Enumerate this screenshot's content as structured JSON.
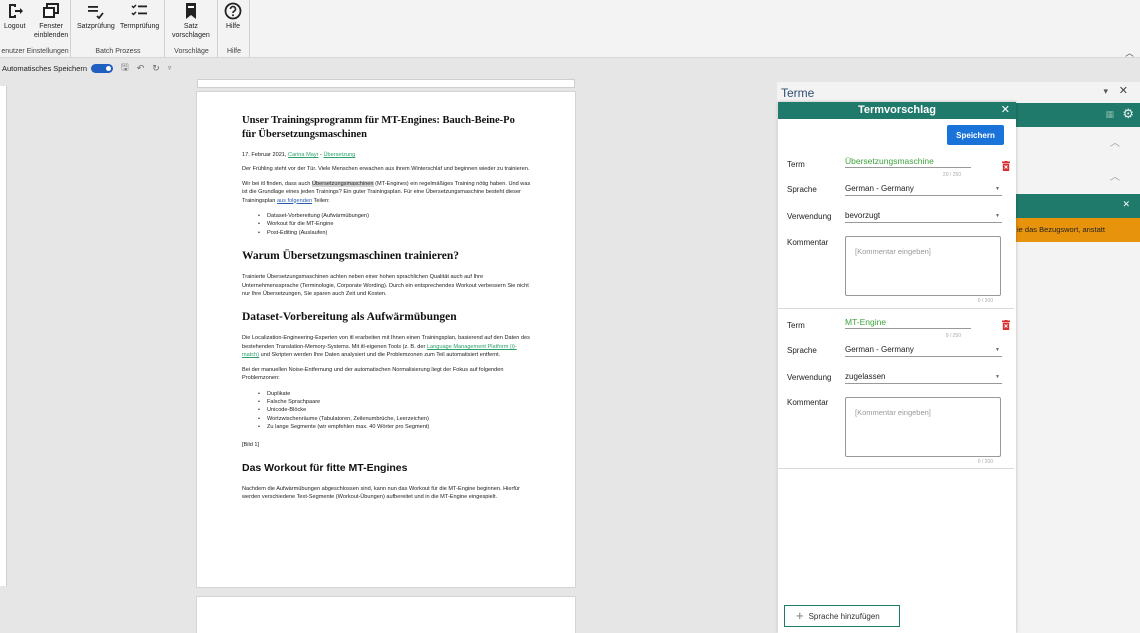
{
  "ribbon": {
    "groups": [
      {
        "label": "Benutzer Einstellungen",
        "buttons": [
          "Logout",
          "Fenster einblenden"
        ]
      },
      {
        "label": "Batch Prozess",
        "buttons": [
          "Satzprüfung",
          "Termprüfung"
        ]
      },
      {
        "label": "Vorschläge",
        "buttons": [
          "Satz vorschlagen"
        ]
      },
      {
        "label": "Hilfe",
        "buttons": [
          "Hilfe"
        ]
      }
    ],
    "logout": "Logout",
    "fenster_line1": "Fenster",
    "fenster_line2": "einblenden",
    "satzpruefung": "Satzprüfung",
    "termpruefung": "Termprüfung",
    "satz_line1": "Satz",
    "satz_line2": "vorschlagen",
    "hilfe": "Hilfe",
    "group_benutzer": "enutzer Einstellungen",
    "group_batch": "Batch Prozess",
    "group_vorschlaege": "Vorschläge",
    "group_hilfe": "Hilfe"
  },
  "qat": {
    "autosave_label": "Automatisches Speichern"
  },
  "document": {
    "title": "Unser Trainingsprogramm für MT-Engines: Bauch-Beine-Po für Übersetzungsmaschinen",
    "meta_date": "17. Februar 2021, ",
    "meta_author": "Carina Mayr",
    "meta_sep": " - ",
    "meta_category": "Übersetzung",
    "p1": "Der Frühling steht vor der Tür. Viele Menschen erwachen aus ihrem Winterschlaf und beginnen wieder zu trainieren.",
    "p2_a": "Wir bei itl finden, dass auch ",
    "p2_hl": "Übersetzungsmaschinen",
    "p2_b": " (MT-Engines) ein regelmäßiges Training nötig haben. Und was ist die Grundlage eines jeden Trainings? Ein guter Trainingsplan. Für eine Übersetzungsmaschine besteht dieser Trainingsplan ",
    "p2_link": "aus folgenden",
    "p2_c": " Teilen:",
    "list1": [
      "Dataset-Vorbereitung (Aufwärmübungen)",
      "Workout für die MT-Engine",
      "Post-Editing (Auslaufen)"
    ],
    "h2_1": "Warum Übersetzungsmaschinen trainieren?",
    "p3": "Trainierte Übersetzungsmaschinen achten neben einer hohen sprachlichen Qualität auch auf Ihre Unternehmenssprache (Terminologie, Corporate Wording). Durch ein entsprechendes Workout verbessern Sie nicht nur Ihre Übersetzungen, Sie sparen auch Zeit und Kosten.",
    "h2_2": "Dataset-Vorbereitung als Aufwärmübungen",
    "p4_a": "Die Localization-Engineering-Experten von itl erarbeiten mit Ihnen einen Trainingsplan, basierend auf den Daten des bestehenden Translation-Memory-Systems. Mit itl-eigenen Tools (z. B. der ",
    "p4_link": "Language Management Platform (i)-match)",
    "p4_b": " und Skripten werden Ihre Daten analysiert und die Problemzonen zum Teil automatisiert entfernt.",
    "p5": "Bei der manuellen Noise-Entfernung und der automatischen Normalisierung liegt der Fokus auf folgenden Problemzonen:",
    "list2": [
      "Duplikate",
      "Falsche Sprachpaare",
      "Unicode-Blöcke",
      "Wortzwischenräume (Tabulatoren, Zeilenumbrüche, Leerzeichen)",
      "Zu lange Segmente (wir empfehlen max. 40 Wörter pro Segment)"
    ],
    "bild": "[Bild 1]",
    "h2_3": "Das Workout für fitte MT-Engines",
    "p6": "Nachdem die Aufwärmübungen abgeschlossen sind, kann nun das Workout für die MT-Engine beginnen. Hierfür werden verschiedene Text-Segmente (Workout-Übungen) aufbereitet und in die MT-Engine eingespielt."
  },
  "terme_panel": {
    "title": "Terme",
    "orange_text": "ie das Bezugswort, anstatt"
  },
  "dialog": {
    "title": "Termvorschlag",
    "save_label": "Speichern",
    "labels": {
      "term": "Term",
      "sprache": "Sprache",
      "verwendung": "Verwendung",
      "kommentar": "Kommentar"
    },
    "terms": [
      {
        "term": "Übersetzungsmaschine",
        "count": "20 / 250",
        "sprache": "German - Germany",
        "verwendung": "bevorzugt",
        "comment_placeholder": "[Kommentar eingeben]",
        "comment_count": "0 / 200"
      },
      {
        "term": "MT-Engine",
        "count": "9 / 250",
        "sprache": "German - Germany",
        "verwendung": "zugelassen",
        "comment_placeholder": "[Kommentar eingeben]",
        "comment_count": "0 / 200"
      }
    ],
    "add_language_label": "Sprache hinzufügen"
  },
  "colors": {
    "teal": "#1f7a6b",
    "save_blue": "#1a73d9",
    "term_green": "#3da33d",
    "orange": "#e8930c",
    "delete_red": "#d93030"
  }
}
